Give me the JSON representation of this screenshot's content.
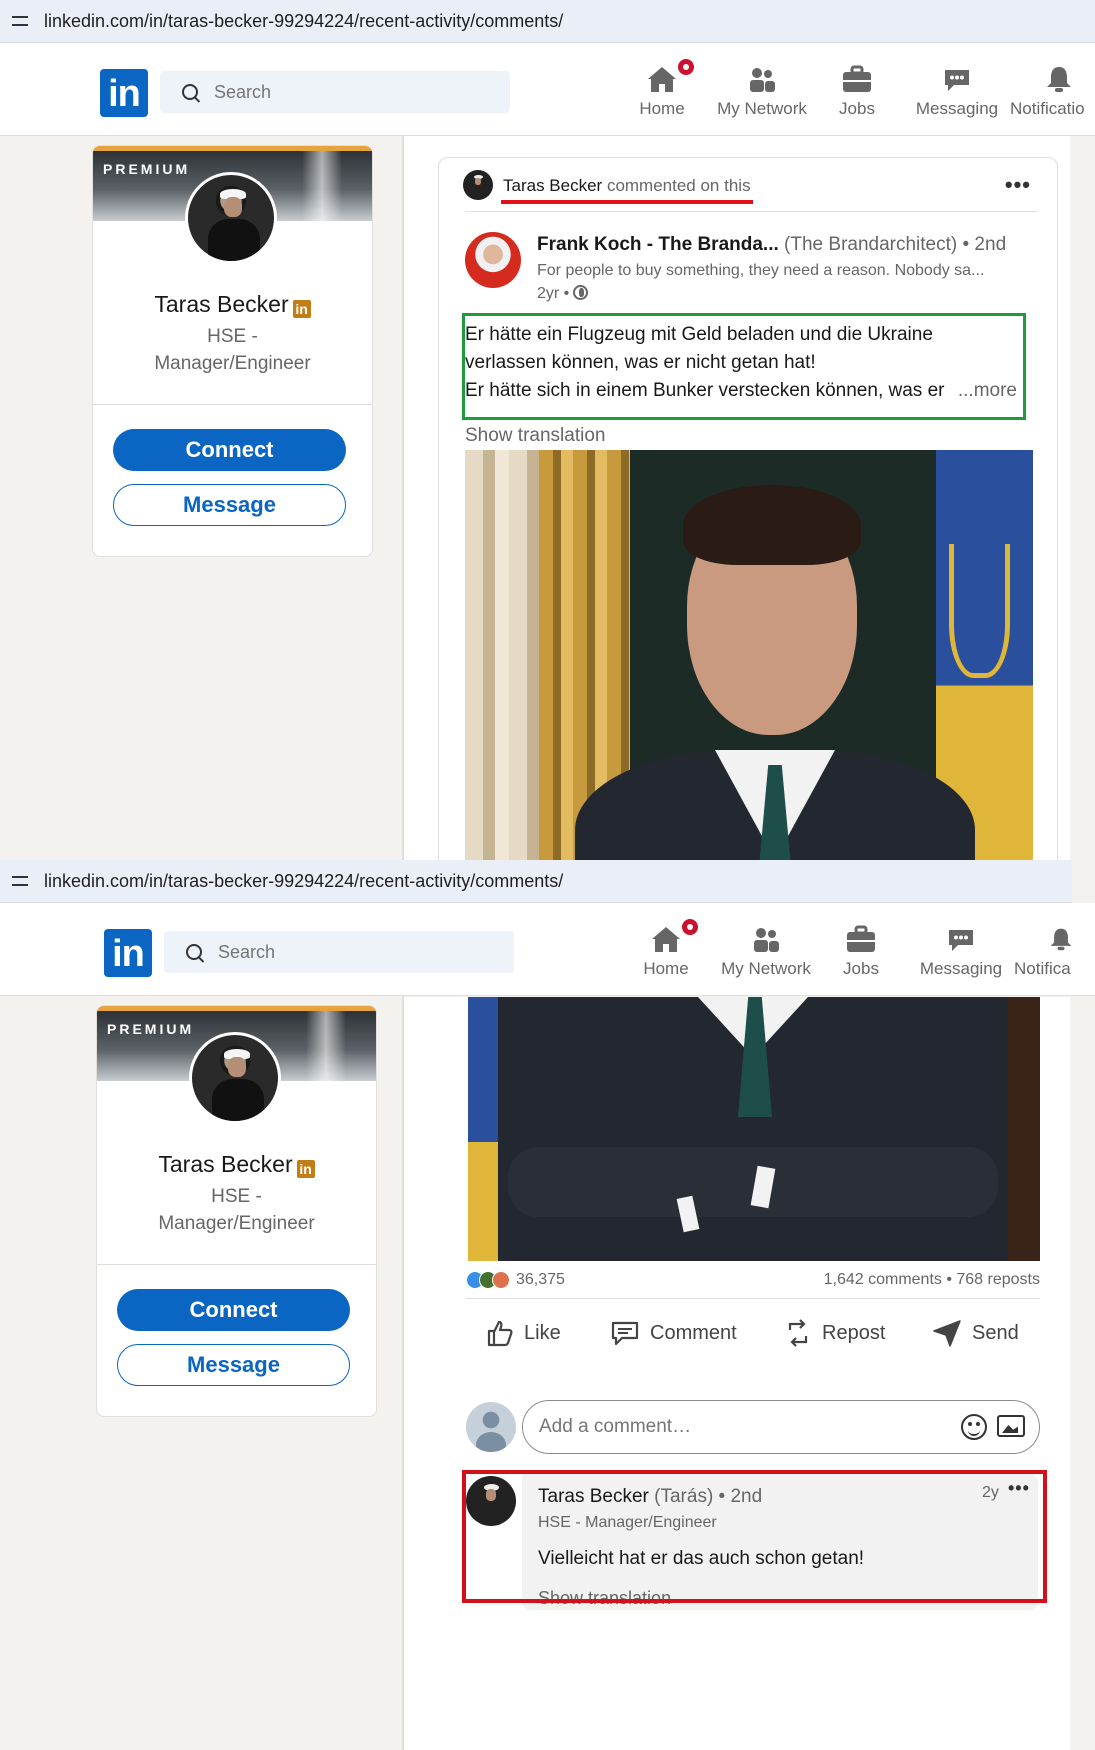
{
  "browser": {
    "url": "linkedin.com/in/taras-becker-99294224/recent-activity/comments/"
  },
  "nav": {
    "logo": "in",
    "search_placeholder": "Search",
    "items": [
      {
        "label": "Home",
        "icon": "home-icon"
      },
      {
        "label": "My Network",
        "icon": "network-icon"
      },
      {
        "label": "Jobs",
        "icon": "briefcase-icon"
      },
      {
        "label": "Messaging",
        "icon": "messaging-icon"
      },
      {
        "label": "Notifications",
        "icon": "bell-icon"
      }
    ],
    "items_cropped": {
      "notifications_shot1": "Notificatio",
      "notifications_shot2": "Notifica"
    }
  },
  "profile": {
    "banner_text": "PREMIUM",
    "name": "Taras Becker",
    "premium_badge": "in",
    "headline_line1": "HSE -",
    "headline_line2": "Manager/Engineer",
    "connect_label": "Connect",
    "message_label": "Message"
  },
  "post": {
    "activity_name": "Taras Becker",
    "activity_text": "commented on this",
    "author_name": "Frank Koch - The Branda...",
    "author_alias": "(The Brandarchitect) • 2nd",
    "author_subtitle": "For people to buy something, they need a reason. Nobody sa...",
    "author_time": "2yr •",
    "text_lines": [
      "Er hätte ein Flugzeug mit Geld beladen und die Ukraine",
      "verlassen können, was er nicht getan hat!",
      "Er hätte sich in einem Bunker verstecken können, was er"
    ],
    "more_label": "...more",
    "show_translation": "Show translation",
    "reactions_count": "36,375",
    "comments_reposts": "1,642 comments • 768 reposts",
    "actions": [
      {
        "label": "Like",
        "icon": "thumbs-up-icon"
      },
      {
        "label": "Comment",
        "icon": "comment-icon"
      },
      {
        "label": "Repost",
        "icon": "repost-icon"
      },
      {
        "label": "Send",
        "icon": "send-icon"
      }
    ],
    "comment_placeholder": "Add a comment…"
  },
  "comment": {
    "name": "Taras Becker",
    "alias": "(Tarás) • 2nd",
    "headline": "HSE - Manager/Engineer",
    "text": "Vielleicht hat er das auch schon getan!",
    "time": "2y",
    "show_translation": "Show translation"
  },
  "colors": {
    "brand": "#0a66c2",
    "highlight_green": "#1e9b3c",
    "highlight_red": "#d3111c",
    "premium_gold": "#c37d16"
  }
}
